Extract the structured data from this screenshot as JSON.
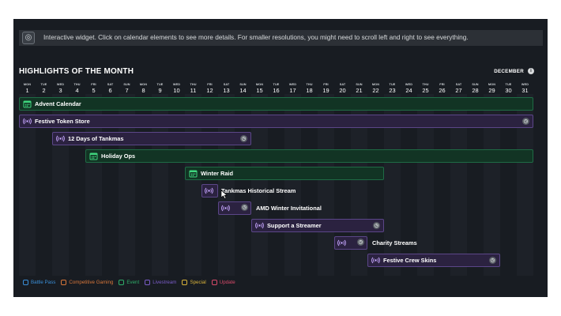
{
  "info": {
    "text": "Interactive widget. Click on calendar elements to see more details. For smaller resolutions, you might need to scroll left and right to see everything."
  },
  "calendar": {
    "title": "HIGHLIGHTS OF THE MONTH",
    "month": "DECEMBER",
    "days": [
      {
        "dow": "MON",
        "num": "1"
      },
      {
        "dow": "TUE",
        "num": "2"
      },
      {
        "dow": "WED",
        "num": "3"
      },
      {
        "dow": "THU",
        "num": "4"
      },
      {
        "dow": "FRI",
        "num": "5"
      },
      {
        "dow": "SAT",
        "num": "6"
      },
      {
        "dow": "SUN",
        "num": "7"
      },
      {
        "dow": "MON",
        "num": "8"
      },
      {
        "dow": "TUE",
        "num": "9"
      },
      {
        "dow": "WED",
        "num": "10"
      },
      {
        "dow": "THU",
        "num": "11"
      },
      {
        "dow": "FRI",
        "num": "12"
      },
      {
        "dow": "SAT",
        "num": "13"
      },
      {
        "dow": "SUN",
        "num": "14"
      },
      {
        "dow": "MON",
        "num": "15"
      },
      {
        "dow": "TUE",
        "num": "16"
      },
      {
        "dow": "WED",
        "num": "17"
      },
      {
        "dow": "THU",
        "num": "18"
      },
      {
        "dow": "FRI",
        "num": "19"
      },
      {
        "dow": "SAT",
        "num": "20"
      },
      {
        "dow": "SUN",
        "num": "21"
      },
      {
        "dow": "MON",
        "num": "22"
      },
      {
        "dow": "TUE",
        "num": "23"
      },
      {
        "dow": "WED",
        "num": "24"
      },
      {
        "dow": "THU",
        "num": "25"
      },
      {
        "dow": "FRI",
        "num": "26"
      },
      {
        "dow": "SAT",
        "num": "27"
      },
      {
        "dow": "SUN",
        "num": "28"
      },
      {
        "dow": "MON",
        "num": "29"
      },
      {
        "dow": "TUE",
        "num": "30"
      },
      {
        "dow": "WED",
        "num": "31"
      }
    ],
    "events": [
      {
        "label": "Advent Calendar",
        "type": "event",
        "start": 1,
        "end": 31,
        "icon": "calendar-icon",
        "end_icon": false
      },
      {
        "label": "Festive Token Store",
        "type": "live",
        "start": 1,
        "end": 31,
        "icon": "broadcast-icon",
        "end_icon": true
      },
      {
        "label": "12 Days of Tankmas",
        "type": "live",
        "start": 3,
        "end": 14,
        "icon": "broadcast-icon",
        "end_icon": true
      },
      {
        "label": "Holiday Ops",
        "type": "event",
        "start": 5,
        "end": 31,
        "icon": "calendar-icon",
        "end_icon": false
      },
      {
        "label": "Winter Raid",
        "type": "event",
        "start": 11,
        "end": 22,
        "icon": "calendar-icon",
        "end_icon": false
      },
      {
        "label": "Tankmas Historical Stream",
        "type": "live",
        "start": 12,
        "end": 12,
        "icon": "broadcast-icon",
        "end_icon": false
      },
      {
        "label": "AMD Winter Invitational",
        "type": "live",
        "start": 13,
        "end": 14,
        "icon": "broadcast-icon",
        "end_icon": true
      },
      {
        "label": "Support a Streamer",
        "type": "live",
        "start": 15,
        "end": 22,
        "icon": "broadcast-icon",
        "end_icon": true
      },
      {
        "label": "Charity Streams",
        "type": "live",
        "start": 20,
        "end": 21,
        "icon": "broadcast-icon",
        "end_icon": true
      },
      {
        "label": "Festive Crew Skins",
        "type": "live",
        "start": 22,
        "end": 29,
        "icon": "broadcast-icon",
        "end_icon": true
      }
    ]
  },
  "legend": [
    {
      "label": "Battle Pass",
      "color": "#3a8fd8"
    },
    {
      "label": "Competitive Gaming",
      "color": "#d8763a"
    },
    {
      "label": "Event",
      "color": "#2fae6a"
    },
    {
      "label": "Livestream",
      "color": "#7a5cc8"
    },
    {
      "label": "Special",
      "color": "#d8b23a"
    },
    {
      "label": "Update",
      "color": "#d84a6a"
    }
  ]
}
